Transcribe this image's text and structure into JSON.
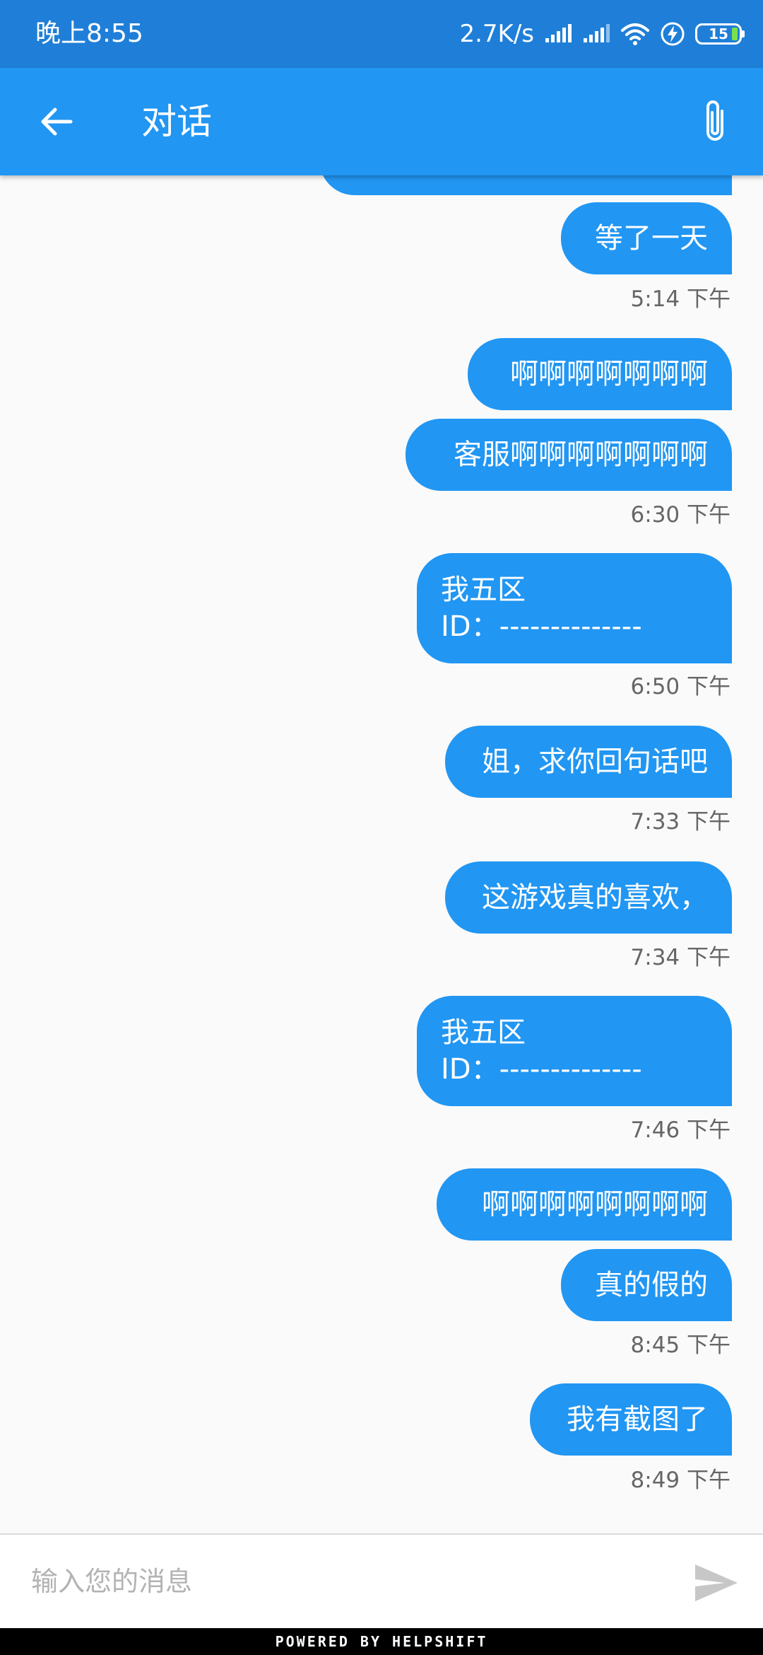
{
  "status_bar": {
    "time": "晚上8:55",
    "network_speed": "2.7K/s",
    "battery_level": "15",
    "icons": [
      "signal-icon",
      "signal-icon",
      "wifi-icon",
      "charging-icon",
      "battery-icon"
    ]
  },
  "header": {
    "title": "对话",
    "back_icon": "arrow-left-icon",
    "attach_icon": "paperclip-icon"
  },
  "messages": [
    {
      "text": "",
      "time": ""
    },
    {
      "text": "等了一天",
      "time": "5:14 下午"
    },
    {
      "text": "啊啊啊啊啊啊啊",
      "time": ""
    },
    {
      "text": "客服啊啊啊啊啊啊啊",
      "time": "6:30 下午"
    },
    {
      "text": "我五区\nID：--------------",
      "time": "6:50 下午"
    },
    {
      "text": "姐，求你回句话吧",
      "time": "7:33 下午"
    },
    {
      "text": "这游戏真的喜欢，",
      "time": "7:34 下午"
    },
    {
      "text": "我五区\nID：--------------",
      "time": "7:46 下午"
    },
    {
      "text": "啊啊啊啊啊啊啊啊",
      "time": ""
    },
    {
      "text": "真的假的",
      "time": "8:45 下午"
    },
    {
      "text": "我有截图了",
      "time": "8:49 下午"
    }
  ],
  "compose": {
    "placeholder": "输入您的消息",
    "value": "",
    "send_icon": "send-icon"
  },
  "footer": {
    "text": "POWERED BY HELPSHIFT"
  },
  "colors": {
    "status_bar": "#1f7fd8",
    "app_bar": "#2196f3",
    "bubble": "#2196f3",
    "background": "#fafafa",
    "timestamp": "#666666",
    "send_icon": "#c7c7c7"
  }
}
